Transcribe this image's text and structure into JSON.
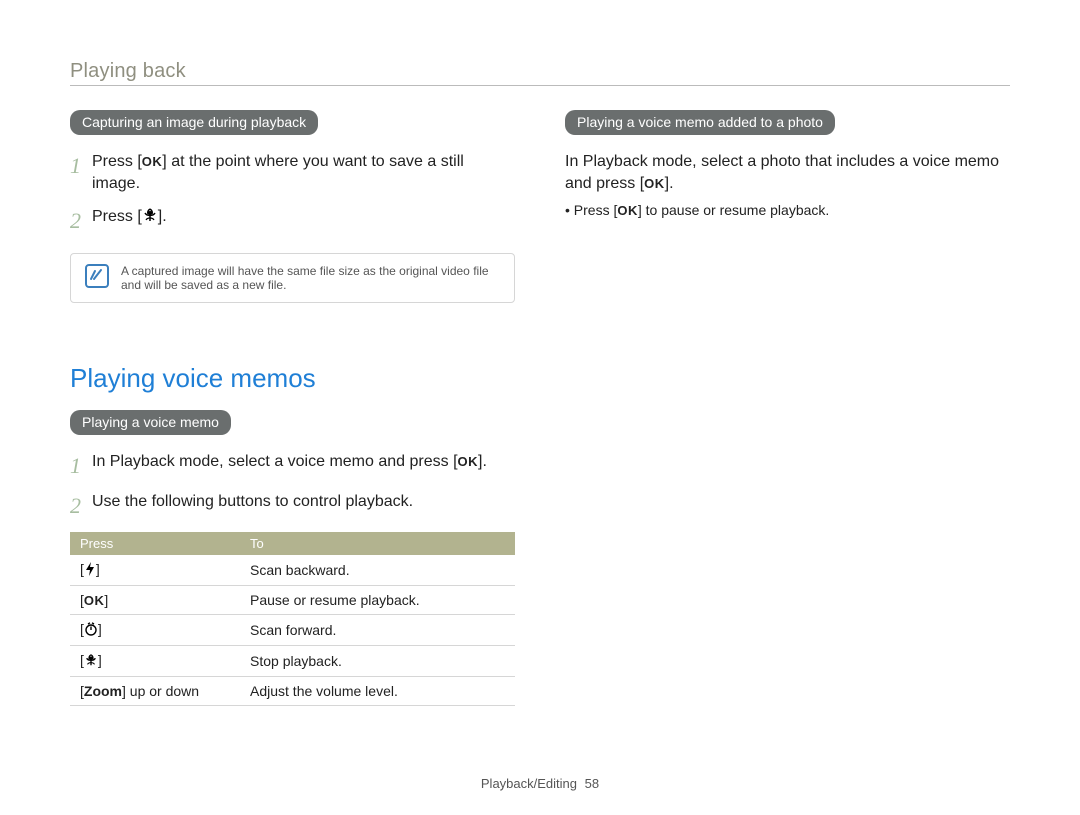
{
  "header": {
    "section": "Playing back"
  },
  "left": {
    "pill1": "Capturing an image during playback",
    "step1_pre": "Press [",
    "step1_post": "] at the point where you want to save a still image.",
    "step2_pre": "Press [",
    "step2_post": "].",
    "note": "A captured image will have the same file size as the original video file and will be saved as a new file.",
    "h2": "Playing voice memos",
    "pill2": "Playing a voice memo",
    "vm_step1_pre": "In Playback mode, select a voice memo and press [",
    "vm_step1_post": "].",
    "vm_step2": "Use the following buttons to control playback.",
    "table": {
      "head_press": "Press",
      "head_to": "To",
      "rows": [
        {
          "to": "Scan backward."
        },
        {
          "to": "Pause or resume playback."
        },
        {
          "to": "Scan forward."
        },
        {
          "to": "Stop playback."
        },
        {
          "press_label_a": "[",
          "press_label_b": "Zoom",
          "press_label_c": "] up or down",
          "to": "Adjust the volume level."
        }
      ]
    }
  },
  "right": {
    "pill": "Playing a voice memo added to a photo",
    "para_pre": "In Playback mode, select a photo that includes a voice memo and press [",
    "para_post": "].",
    "bullet_pre": "• Press [",
    "bullet_post": "] to pause or resume playback."
  },
  "footer": {
    "chapter": "Playback/Editing",
    "page": "58"
  },
  "glyphs": {
    "ok": "OK"
  }
}
